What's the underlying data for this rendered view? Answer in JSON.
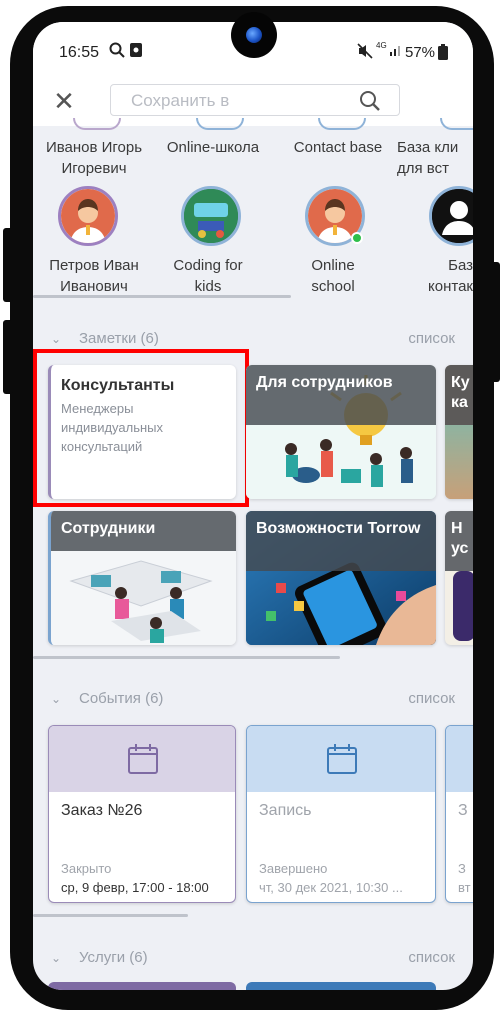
{
  "status_bar": {
    "time": "16:55",
    "network": "4G",
    "battery": "57%"
  },
  "toolbar": {
    "search_placeholder": "Сохранить в"
  },
  "contacts_row1": [
    {
      "name": "Иванов Игорь\nИгоревич"
    },
    {
      "name": "Online-школа"
    },
    {
      "name": "Contact base"
    },
    {
      "name": "База кли\nдля вст"
    }
  ],
  "contacts_row2": [
    {
      "name": "Петров Иван\nИванович"
    },
    {
      "name": "Coding for\nkids"
    },
    {
      "name": "Online\nschool"
    },
    {
      "name": "Баз\nконтак"
    }
  ],
  "notes": {
    "title": "Заметки (6)",
    "link": "список",
    "cards": [
      {
        "title": "Консультанты",
        "description": "Менеджеры индивидуальных консультаций"
      },
      {
        "title": "Для сотрудников"
      },
      {
        "title": "Ку\nка"
      },
      {
        "title": "Сотрудники"
      },
      {
        "title": "Возможности Torrow"
      },
      {
        "title": "Н\nус"
      }
    ]
  },
  "events": {
    "title": "События (6)",
    "link": "список",
    "cards": [
      {
        "title": "Заказ №26",
        "status": "Закрыто",
        "date": "ср, 9 февр, 17:00 - 18:00",
        "accent": "#d9d3e6"
      },
      {
        "title": "Запись",
        "status": "Завершено",
        "date": "чт, 30 дек 2021, 10:30 ...",
        "accent": "#c8dcf2"
      },
      {
        "title": "З",
        "status": "З",
        "date": "вт",
        "accent": "#c8dcf2"
      }
    ]
  },
  "services": {
    "title": "Услуги (6)",
    "link": "список"
  },
  "colors": {
    "highlight": "#ff0000",
    "online": "#2fbf4a"
  }
}
